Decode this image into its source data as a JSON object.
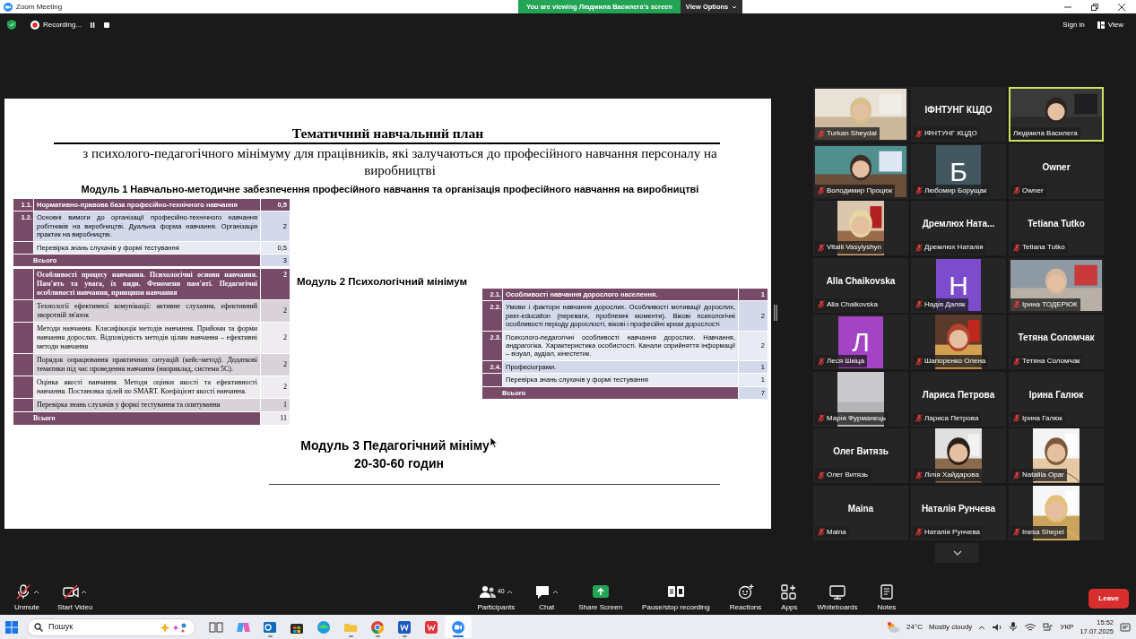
{
  "window": {
    "title": "Zoom Meeting"
  },
  "share_banner": {
    "text": "You are viewing Людмила Василега's screen",
    "button": "View Options"
  },
  "top_bar": {
    "recording_label": "Recording...",
    "sign_in": "Sign in",
    "view": "View"
  },
  "slide": {
    "title": "Тематичний навчальний план",
    "subtitle": "з психолого-педагогічного мінімуму для працівників, які залучаються до професійного навчання персоналу на виробництві",
    "module_1_heading": "Модуль 1 Навчально-методичне забезпечення професійного навчання та організація професійного навчання на виробництві",
    "module_1_table": [
      {
        "number": "1.1.",
        "topic": "Нормативно-правова база професійно-технічного навчання",
        "hours": "0,5",
        "kind": "header"
      },
      {
        "number": "1.2.",
        "topic": "Основні вимоги до організації професійно-технічного навчання робітників на виробництві. Дуальна форма навчання. Організація практик на виробництві.",
        "hours": "2",
        "kind": "blue"
      },
      {
        "topic": "Перевірка знань слухачів у формі тестування",
        "hours": "0,5",
        "kind": "bluepale"
      },
      {
        "topic": "Всього",
        "hours": "3",
        "kind": "total"
      }
    ],
    "module_2_heading": "Модуль 2 Психологічний мінімум",
    "module_2_table": [
      {
        "number": "2.1.",
        "topic": "Особливості навчання дорослого населення.",
        "hours": "1",
        "kind": "header"
      },
      {
        "number": "2.2.",
        "topic": "Умови і фактори навчання дорослих. Особливості мотивації дорослих, peer-education (переваги, проблемні моменти). Вікові психологічні особливості періоду дорослості, вікові і професійні кризи дорослості",
        "hours": "2",
        "kind": "blue"
      },
      {
        "number": "2.3.",
        "topic": "Психолого-педагогічні особливості навчання дорослих. Навчання, андрагогіка. Характеристика особистості. Канали сприйняття інформації – візуал, аудіал, кінестетик.",
        "hours": "2",
        "kind": "bluepale"
      },
      {
        "number": "2.4.",
        "topic": "Професіограми.",
        "hours": "1",
        "kind": "blue"
      },
      {
        "topic": "Перевірка знань слухачів у формі тестування",
        "hours": "1",
        "kind": "bluepale"
      },
      {
        "topic": "Всього",
        "hours": "7",
        "kind": "total"
      }
    ],
    "module_3_heading": "Модуль 3 Педагогічний мініму",
    "module_3_hours": "20-30-60 годин",
    "module_3_table": [
      {
        "topic": "Особливості процесу навчання. Психологічні основи навчання. Пам'ять та увага, їх види. Феномени пам'яті.  Педагогічні особливості навчання, принципи навчання",
        "hours": "2",
        "kind": "header"
      },
      {
        "topic": "Технології ефективної комунікації: активне слухання, ефективний зворотній зв'язок",
        "hours": "2",
        "kind": "grey"
      },
      {
        "topic": "Методи навчання. Класифікація методів навчання. Прийоми та форми навчання дорослих. Відповідність методів цілям навчання – ефективні методи навчання",
        "hours": "2",
        "kind": "pale"
      },
      {
        "topic": "Порядок опрацювання практичних ситуацій (кейс-метод). Додаткові тематики під час проведення навчання (наприклад, система 5С).",
        "hours": "2",
        "kind": "grey"
      },
      {
        "topic": "Оцінка якості навчання. Методи оцінки якості та ефективності навчання. Постановка цілей по SMART. Коефіцієнт якості навчання.",
        "hours": "2",
        "kind": "pale"
      },
      {
        "topic": "Перевірка знань слухачів у формі тестування та опитування",
        "hours": "1",
        "kind": "grey"
      },
      {
        "topic": "Всього",
        "hours": "11",
        "kind": "total"
      }
    ]
  },
  "participants": [
    {
      "name": "Turkan Sheydai",
      "kind": "video",
      "muted": true,
      "selected": false
    },
    {
      "name": "ІФНТУНГ КЦДО",
      "kind": "name",
      "label": "ІФНТУНГ КЦДО",
      "muted": true,
      "selected": false
    },
    {
      "name": "Людмила Василега",
      "kind": "video",
      "muted": false,
      "selected": true
    },
    {
      "name": "Володимир Процюк",
      "kind": "video",
      "muted": true,
      "selected": false
    },
    {
      "name": "Любомир Борущак",
      "kind": "letter",
      "initial": "Б",
      "color": "#435761",
      "muted": true,
      "selected": false
    },
    {
      "name": "Owner",
      "kind": "name",
      "label": "Owner",
      "muted": true,
      "selected": false
    },
    {
      "name": "Vitalii Vasylyshyn",
      "muted": true,
      "selected": false
    },
    {
      "name": "Дремлюх Наталія",
      "kind": "name",
      "label": "Дремлюх  Ната...",
      "muted": true,
      "selected": false
    },
    {
      "name": "Tetiana Tutko",
      "kind": "name",
      "label": "Tetiana Tutko",
      "muted": true,
      "selected": false
    },
    {
      "name": "Alla Chaikovska",
      "kind": "name",
      "label": "Alla Chaikovska",
      "muted": true,
      "selected": false
    },
    {
      "name": "Надія Даляк",
      "kind": "letter",
      "initial": "Н",
      "color": "#7b4ccb",
      "muted": true,
      "selected": false
    },
    {
      "name": "Ірина ТОДЕРЮК",
      "kind": "video",
      "muted": true,
      "selected": false
    },
    {
      "name": "Леся Шкіца",
      "kind": "letter",
      "initial": "Л",
      "color": "#a443c4",
      "muted": true,
      "selected": false
    },
    {
      "name": "Шапоренко Олена",
      "muted": true,
      "selected": false
    },
    {
      "name": "Тетяна Соломчак",
      "kind": "name",
      "label": "Тетяна Соломчак",
      "muted": true,
      "selected": false
    },
    {
      "name": "Марія Фурманець",
      "muted": true,
      "selected": false
    },
    {
      "name": "Лариса Петрова",
      "kind": "name",
      "label": "Лариса Петрова",
      "muted": true,
      "selected": false
    },
    {
      "name": "Ірина Галюк",
      "kind": "name",
      "label": "Ірина Галюк",
      "muted": true,
      "selected": false
    },
    {
      "name": "Олег Витязь",
      "kind": "name",
      "label": "Олег Витязь",
      "muted": true,
      "selected": false
    },
    {
      "name": "Лілія Хайдарова",
      "muted": true,
      "selected": false
    },
    {
      "name": "Nataliia Opar",
      "muted": true,
      "selected": false
    },
    {
      "name": "Maina",
      "kind": "name",
      "label": "Maina",
      "muted": true,
      "selected": false
    },
    {
      "name": "Наталія Рунчева",
      "kind": "name",
      "label": "Наталія Рунчева",
      "muted": true,
      "selected": false
    },
    {
      "name": "Inesa Shepel",
      "muted": true,
      "selected": false
    }
  ],
  "toolbar": [
    {
      "kind": "mic",
      "label": "Unmute",
      "caret": true,
      "off": true
    },
    {
      "kind": "camera",
      "label": "Start Video",
      "caret": true,
      "off": true
    },
    {
      "kind": "participants",
      "label": "Participants",
      "count": "40",
      "caret": true
    },
    {
      "kind": "chat",
      "label": "Chat",
      "caret": true
    },
    {
      "kind": "share",
      "label": "Share Screen",
      "caret": false
    },
    {
      "kind": "record",
      "label": "Pause/stop recording",
      "caret": false
    },
    {
      "kind": "reactions",
      "label": "Reactions",
      "caret": false
    },
    {
      "kind": "apps",
      "label": "Apps",
      "caret": false
    },
    {
      "kind": "whiteboards",
      "label": "Whiteboards",
      "caret": false
    },
    {
      "kind": "notes",
      "label": "Notes",
      "caret": false
    }
  ],
  "leave": "Leave",
  "taskbar": {
    "search_placeholder": "Пошук",
    "apps": [
      {
        "kind": "taskview",
        "running": false
      },
      {
        "kind": "copilot",
        "running": false
      },
      {
        "kind": "mail",
        "running": true
      },
      {
        "kind": "store",
        "running": false
      },
      {
        "kind": "edge",
        "running": false
      },
      {
        "kind": "folder",
        "running": true
      },
      {
        "kind": "chrome",
        "running": true
      },
      {
        "kind": "word",
        "running": true
      },
      {
        "kind": "wps",
        "running": false
      },
      {
        "kind": "zoom",
        "running": true
      }
    ],
    "weather_temp": "24°C",
    "weather_text": "Mostly cloudy",
    "language": "УКР",
    "time": "15:52",
    "date": "17.07.2025"
  }
}
